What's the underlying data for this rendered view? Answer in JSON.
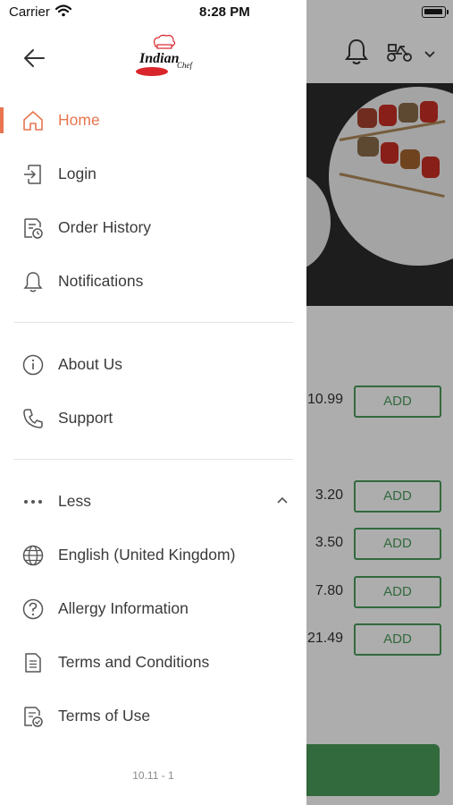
{
  "status_bar": {
    "carrier": "Carrier",
    "time": "8:28 PM"
  },
  "drawer": {
    "main_items": [
      {
        "label": "Home",
        "icon": "home-icon",
        "active": true
      },
      {
        "label": "Login",
        "icon": "login-icon"
      },
      {
        "label": "Order History",
        "icon": "order-history-icon"
      },
      {
        "label": "Notifications",
        "icon": "bell-icon"
      }
    ],
    "info_items": [
      {
        "label": "About Us",
        "icon": "info-icon"
      },
      {
        "label": "Support",
        "icon": "phone-icon"
      }
    ],
    "more_toggle": {
      "label": "Less",
      "icon": "more-dots-icon"
    },
    "extra_items": [
      {
        "label": "English (United Kingdom)",
        "icon": "globe-icon"
      },
      {
        "label": "Allergy Information",
        "icon": "question-icon"
      },
      {
        "label": "Terms and Conditions",
        "icon": "document-icon"
      },
      {
        "label": "Terms of Use",
        "icon": "document-check-icon"
      }
    ],
    "version": "10.11 - 1",
    "accent_color": "#e8754f"
  },
  "background_app": {
    "items": [
      {
        "price": "10.99",
        "button": "ADD"
      },
      {
        "price": "3.20",
        "button": "ADD"
      },
      {
        "price": "3.50",
        "button": "ADD"
      },
      {
        "price": "7.80",
        "button": "ADD"
      },
      {
        "price": "21.49",
        "button": "ADD"
      }
    ],
    "accent_color": "#4a9b5a"
  }
}
